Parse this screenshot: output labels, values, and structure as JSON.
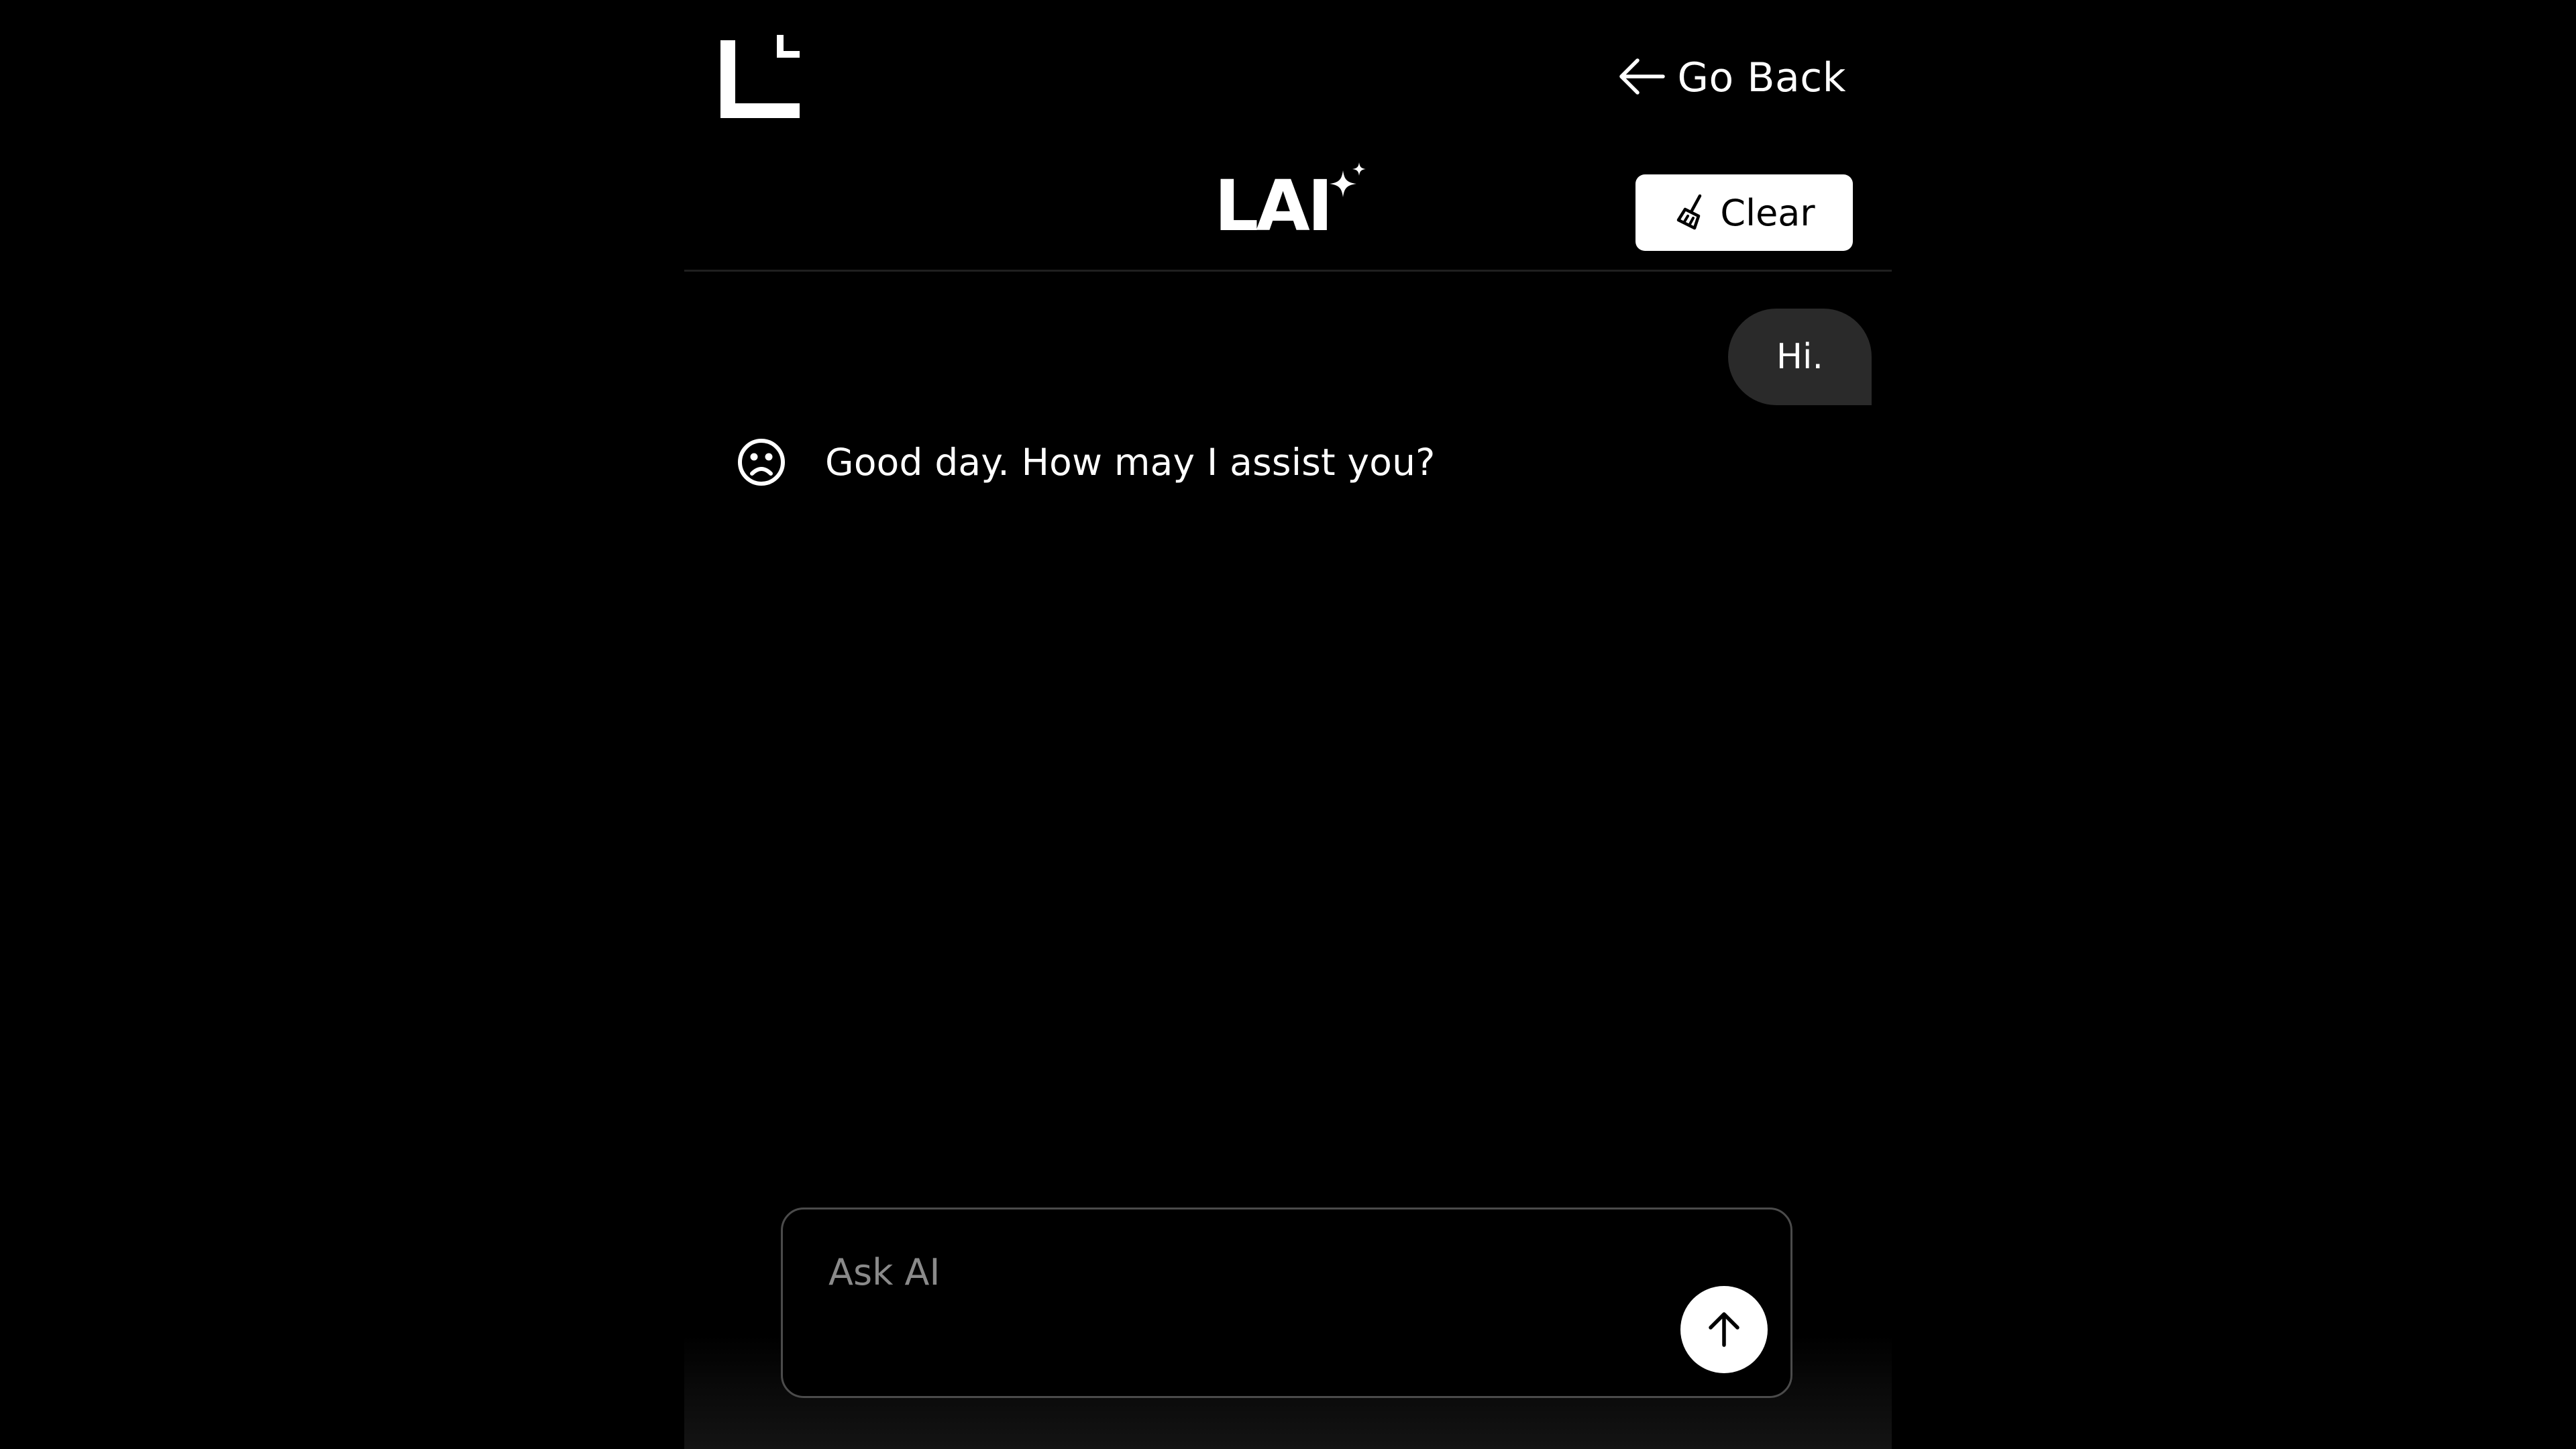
{
  "header": {
    "go_back_label": "Go Back",
    "brand_name": "LAI",
    "clear_label": "Clear"
  },
  "icons": {
    "logo": "corner-l-logo",
    "go_back": "arrow-left-icon",
    "brand_decoration": "sparkle-icon",
    "clear": "broom-icon",
    "assistant_avatar": "frown-face-icon",
    "send": "arrow-up-icon"
  },
  "chat": {
    "messages": [
      {
        "role": "user",
        "text": "Hi."
      },
      {
        "role": "assistant",
        "text": "Good day. How may I assist you?"
      }
    ]
  },
  "composer": {
    "placeholder": "Ask AI",
    "value": ""
  },
  "colors": {
    "background": "#000000",
    "text": "#ffffff",
    "user_bubble": "#2a2a2a",
    "composer_border": "#4b4b4b",
    "placeholder": "#8a8a8a",
    "button_bg": "#ffffff"
  }
}
